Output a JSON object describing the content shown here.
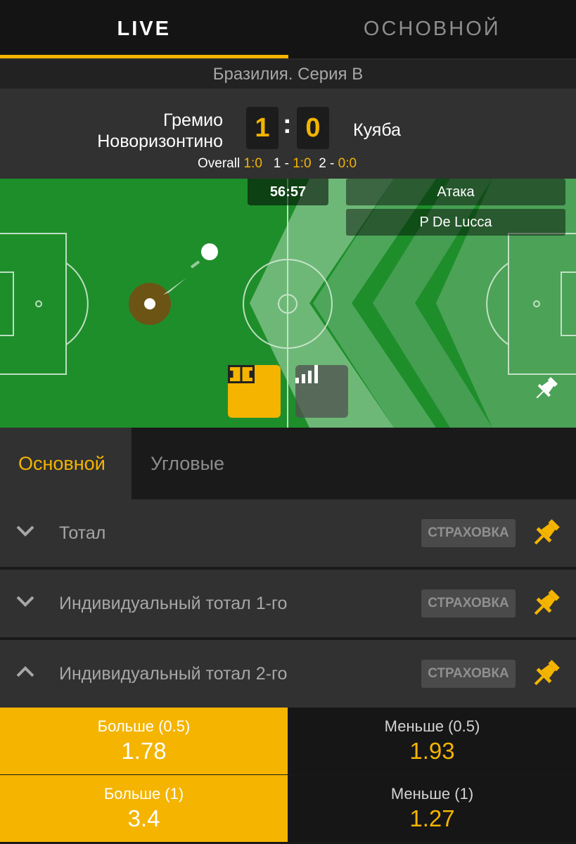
{
  "top_tabs": [
    {
      "label": "LIVE",
      "active": true
    },
    {
      "label": "ОСНОВНОЙ",
      "active": false
    }
  ],
  "league": "Бразилия. Серия В",
  "match": {
    "team1": [
      "Гремио",
      "Новоризонтино"
    ],
    "team2": "Куяба",
    "score1": "1",
    "score_sep": ":",
    "score2": "0",
    "periods": {
      "overall_label": "Overall",
      "overall_score": "1:0",
      "p1_label": "1 -",
      "p1_score": "1:0",
      "p2_label": "2 -",
      "p2_score": "0:0"
    }
  },
  "pitch": {
    "timer": "56:57",
    "event": "Атака",
    "player": "P De Lucca",
    "icons": [
      "field-view-icon",
      "stats-bars-icon",
      "pin-icon"
    ]
  },
  "sub_tabs": [
    {
      "label": "Основной",
      "active": true
    },
    {
      "label": "Угловые",
      "active": false
    }
  ],
  "markets": [
    {
      "title": "Тотал",
      "badge": "СТРАХОВКА",
      "expanded": false
    },
    {
      "title": "Индивидуальный тотал 1-го",
      "badge": "СТРАХОВКА",
      "expanded": false
    },
    {
      "title": "Индивидуальный тотал 2-го",
      "badge": "СТРАХОВКА",
      "expanded": true
    }
  ],
  "odds": [
    {
      "label": "Больше (0.5)",
      "value": "1.78"
    },
    {
      "label": "Меньше (0.5)",
      "value": "1.93"
    },
    {
      "label": "Больше (1)",
      "value": "3.4"
    },
    {
      "label": "Меньше (1)",
      "value": "1.27"
    }
  ],
  "colors": {
    "accent": "#f4b400",
    "pitch": "#1e8e2b",
    "panel": "#313131",
    "background": "#1a1a1a"
  }
}
